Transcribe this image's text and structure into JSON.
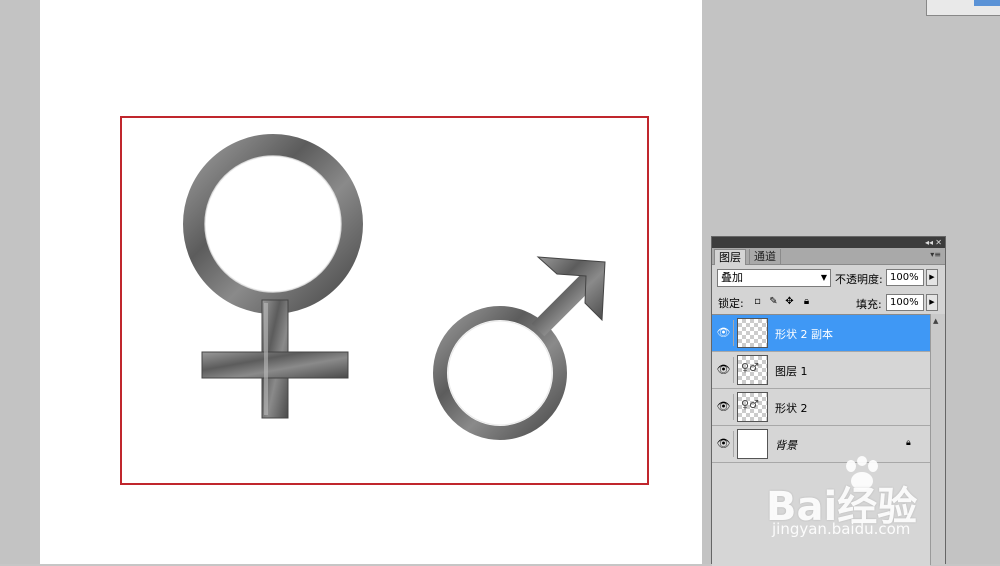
{
  "workspace": {
    "document_background": "#ffffff",
    "workspace_background": "#c3c3c3",
    "selection_color": "#c0262d"
  },
  "artwork": {
    "female_symbol": "♀",
    "male_symbol": "♂",
    "metal_color": "#6e6e6e"
  },
  "layers_panel": {
    "tabs": [
      "图层",
      "通道"
    ],
    "blend_mode": "叠加",
    "opacity_label": "不透明度:",
    "opacity_value": "100%",
    "lock_label": "锁定:",
    "fill_label": "填充:",
    "fill_value": "100%",
    "layers": [
      {
        "name": "形状 2 副本",
        "selected": true,
        "thumbnail": "transparent"
      },
      {
        "name": "图层 1",
        "selected": false,
        "thumbnail": "symbols"
      },
      {
        "name": "形状 2",
        "selected": false,
        "thumbnail": "symbols"
      },
      {
        "name": "背景",
        "selected": false,
        "thumbnail": "white",
        "locked": true
      }
    ],
    "selected_color": "#3f98f5"
  },
  "watermark": {
    "brand": "Bai经验",
    "url": "jingyan.baidu.com"
  }
}
